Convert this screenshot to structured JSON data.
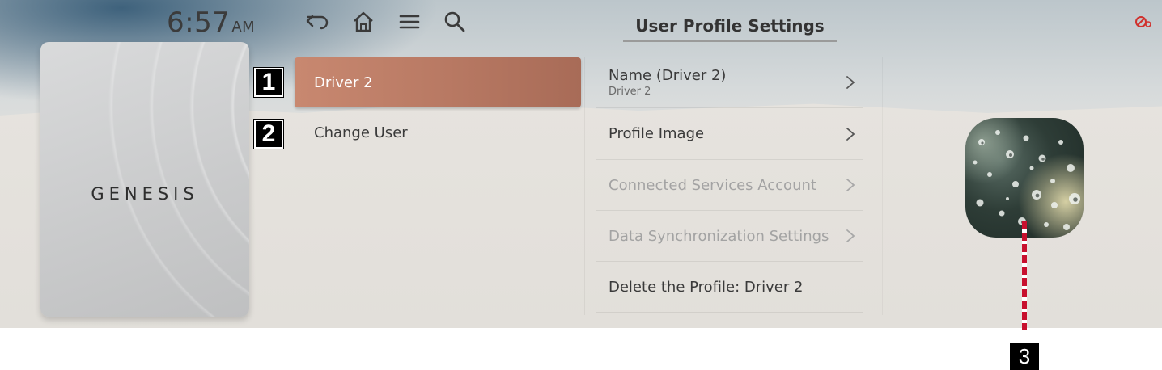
{
  "status_bar": {
    "time": "6:57",
    "ampm": "AM"
  },
  "nav_icons": [
    "back-icon",
    "home-icon",
    "menu-icon",
    "search-icon"
  ],
  "logo": {
    "text": "GENESIS"
  },
  "menu": {
    "items": [
      {
        "label": "Driver 2",
        "selected": true,
        "callout": "1"
      },
      {
        "label": "Change User",
        "selected": false,
        "callout": "2"
      }
    ]
  },
  "page": {
    "title": "User Profile Settings"
  },
  "settings": {
    "items": [
      {
        "label": "Name (Driver 2)",
        "sublabel": "Driver 2",
        "enabled": true,
        "chevron": true
      },
      {
        "label": "Profile Image",
        "enabled": true,
        "chevron": true
      },
      {
        "label": "Connected Services Account",
        "enabled": false,
        "chevron": true
      },
      {
        "label": "Data Synchronization Settings",
        "enabled": false,
        "chevron": true
      },
      {
        "label": "Delete the Profile: Driver 2",
        "enabled": true,
        "chevron": false
      }
    ]
  },
  "profile_image": {
    "callout": "3"
  },
  "colors": {
    "accent": "#b97a64",
    "warning": "#d0312d",
    "callout_line": "#c8102e"
  }
}
